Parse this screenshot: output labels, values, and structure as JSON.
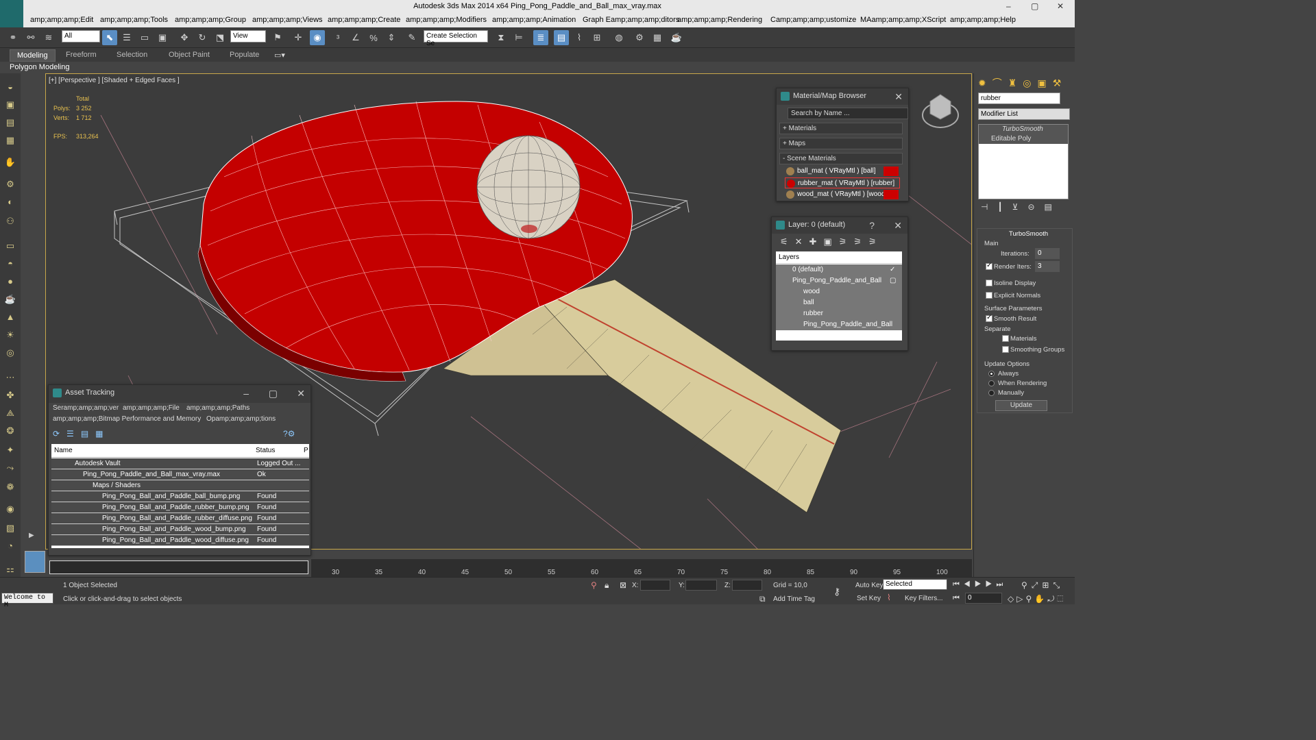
{
  "window": {
    "title": "Autodesk 3ds Max  2014 x64     Ping_Pong_Paddle_and_Ball_max_vray.max",
    "min": "–",
    "max": "▢",
    "close": "✕"
  },
  "menu": [
    "amp;amp;amp;Edit",
    "amp;amp;amp;Tools",
    "amp;amp;amp;Group",
    "amp;amp;amp;Views",
    "amp;amp;amp;Create",
    "amp;amp;amp;Modifiers",
    "amp;amp;amp;Animation",
    "Graph Eamp;amp;amp;ditors",
    "amp;amp;amp;Rendering",
    "Camp;amp;amp;ustomize",
    "MAamp;amp;amp;XScript",
    "amp;amp;amp;Help"
  ],
  "toolbar": {
    "filter_value": "All",
    "refcoord_value": "View",
    "selection_set_placeholder": "Create Selection Se"
  },
  "ribbon": {
    "tabs": [
      "Modeling",
      "Freeform",
      "Selection",
      "Object Paint",
      "Populate"
    ],
    "active_tab": "Modeling",
    "subpanel": "Polygon Modeling"
  },
  "viewport": {
    "label": "[+] [Perspective ] [Shaded + Edged Faces ]",
    "stats": {
      "total_label": "Total",
      "polys_label": "Polys:",
      "polys_value": "3 252",
      "verts_label": "Verts:",
      "verts_value": "1 712",
      "fps_label": "FPS:",
      "fps_value": "313,264"
    }
  },
  "material_browser": {
    "title": "Material/Map Browser",
    "search_placeholder": "Search by Name ...",
    "groups": [
      "+ Materials",
      "+ Maps",
      "- Scene Materials"
    ],
    "items": [
      {
        "label": "ball_mat  ( VRayMtl ) [ball]"
      },
      {
        "label": "rubber_mat  ( VRayMtl ) [rubber]"
      },
      {
        "label": "wood_mat  ( VRayMtl ) [wood]"
      }
    ],
    "close": "✕"
  },
  "layer_window": {
    "title": "Layer: 0 (default)",
    "help": "?",
    "close": "✕",
    "header": "Layers",
    "rows": [
      {
        "label": "0 (default)",
        "indent": 0,
        "mark": "✓"
      },
      {
        "label": "Ping_Pong_Paddle_and_Ball",
        "indent": 0,
        "mark": "▢"
      },
      {
        "label": "wood",
        "indent": 1,
        "mark": ""
      },
      {
        "label": "ball",
        "indent": 1,
        "mark": ""
      },
      {
        "label": "rubber",
        "indent": 1,
        "mark": ""
      },
      {
        "label": "Ping_Pong_Paddle_and_Ball",
        "indent": 1,
        "mark": ""
      }
    ]
  },
  "asset_tracking": {
    "title": "Asset Tracking",
    "menu": [
      "Seramp;amp;amp;ver",
      "amp;amp;amp;File",
      "amp;amp;amp;Paths",
      "amp;amp;amp;Bitmap Performance and Memory",
      "Opamp;amp;amp;tions"
    ],
    "columns": [
      "Name",
      "Status",
      "P"
    ],
    "rows": [
      {
        "name": "Autodesk Vault",
        "status": "Logged Out ...",
        "indent": 1
      },
      {
        "name": "Ping_Pong_Paddle_and_Ball_max_vray.max",
        "status": "Ok",
        "indent": 2
      },
      {
        "name": "Maps / Shaders",
        "status": "",
        "indent": 3
      },
      {
        "name": "Ping_Pong_Ball_and_Paddle_ball_bump.png",
        "status": "Found",
        "indent": 4
      },
      {
        "name": "Ping_Pong_Ball_and_Paddle_rubber_bump.png",
        "status": "Found",
        "indent": 4
      },
      {
        "name": "Ping_Pong_Ball_and_Paddle_rubber_diffuse.png",
        "status": "Found",
        "indent": 4
      },
      {
        "name": "Ping_Pong_Ball_and_Paddle_wood_bump.png",
        "status": "Found",
        "indent": 4
      },
      {
        "name": "Ping_Pong_Ball_and_Paddle_wood_diffuse.png",
        "status": "Found",
        "indent": 4
      }
    ]
  },
  "command_panel": {
    "name_value": "rubber",
    "modifier_list": "Modifier List",
    "stack": [
      "TurboSmooth",
      "Editable Poly"
    ],
    "rollout_title": "TurboSmooth",
    "main_label": "Main",
    "iterations_label": "Iterations:",
    "iterations_value": "0",
    "render_iters_label": "Render Iters:",
    "render_iters_value": "3",
    "isoline_label": "Isoline Display",
    "explicit_label": "Explicit Normals",
    "surface_label": "Surface Parameters",
    "smooth_label": "Smooth Result",
    "separate_label": "Separate",
    "materials_label": "Materials",
    "smoothing_label": "Smoothing Groups",
    "update_options_label": "Update Options",
    "always_label": "Always",
    "when_rendering_label": "When Rendering",
    "manually_label": "Manually",
    "update_button": "Update"
  },
  "timeline": {
    "ticks": [
      "30",
      "35",
      "40",
      "45",
      "50",
      "55",
      "60",
      "65",
      "70",
      "75",
      "80",
      "85",
      "90",
      "95",
      "100"
    ]
  },
  "status": {
    "welcome": "Welcome to M",
    "selected": "1 Object Selected",
    "prompt": "Click or click-and-drag to select objects",
    "x_label": "X:",
    "y_label": "Y:",
    "z_label": "Z:",
    "grid": "Grid = 10,0",
    "add_time_tag": "Add Time Tag",
    "auto_key": "Auto Key",
    "set_key": "Set Key",
    "key_mode_value": "Selected",
    "key_filters": "Key Filters...",
    "frame_value": "0"
  },
  "colors": {
    "rubber": "#cc0000",
    "wood": "#d8cc9c",
    "ball": "#d9d2c4",
    "viewport_bg": "#3c3c3c",
    "accent_border": "#c9a84a"
  }
}
